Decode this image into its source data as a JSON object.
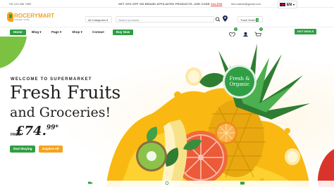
{
  "topbar": {
    "phone": "+00 123 456 7890",
    "promo": "GET 25% OFF ON BRAND AFFILIATED PRODUCTS, USE CODE",
    "promo_code": "SALE50",
    "email": "info.market@gmail.com",
    "language": "EN"
  },
  "header": {
    "logo_main": "ROCERY",
    "logo_accent": "MART",
    "logo_tagline": "GROCERY STORE",
    "category_select": "All Categories",
    "search_placeholder": "Search products...",
    "track_order": "Track Order"
  },
  "nav": {
    "items": [
      {
        "label": "Home"
      },
      {
        "label": "Blog"
      },
      {
        "label": "Page"
      },
      {
        "label": "Shop"
      },
      {
        "label": "Contact"
      }
    ],
    "buy_now": "Buy Now",
    "hot_deals": "HOT DEALS",
    "wishlist_count": "0",
    "cart_count": "0"
  },
  "hero": {
    "eyebrow": "WELCOME TO SUPERMARKET",
    "title_line1": "Fresh Fruits",
    "title_line2": "and Groceries!",
    "from_label": "FROM",
    "price_currency": "£",
    "price_main": "74.",
    "price_cents": "99*",
    "start_button": "Start Buying",
    "explore_button": "Explore All",
    "badge_line1": "Fresh &",
    "badge_line2": "Organic"
  },
  "colors": {
    "brand_green": "#2f9e44",
    "brand_orange": "#f7a21b",
    "sale_red": "#e84c3d"
  }
}
